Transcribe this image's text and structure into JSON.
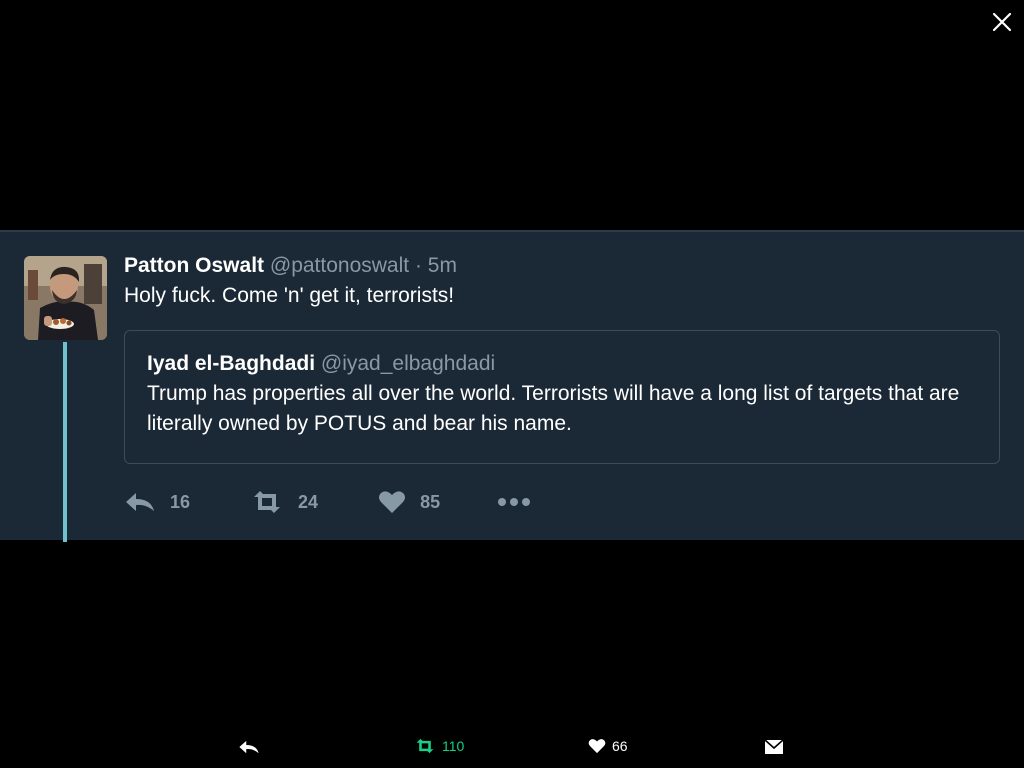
{
  "viewer": {
    "close_icon": "close-icon"
  },
  "tweet": {
    "display_name": "Patton Oswalt",
    "handle": "@pattonoswalt",
    "separator": "·",
    "time": "5m",
    "text": "Holy fuck. Come 'n' get it, terrorists!",
    "quoted": {
      "display_name": "Iyad el-Baghdadi",
      "handle": "@iyad_elbaghdadi",
      "text": "Trump has properties all over the world. Terrorists will have a long list of targets that are literally owned by POTUS and bear his name."
    },
    "actions": {
      "reply_count": "16",
      "retweet_count": "24",
      "like_count": "85",
      "more_icon": "more-dots-icon"
    }
  },
  "bottom_bar": {
    "retweet_count": "110",
    "like_count": "66",
    "colors": {
      "retweet": "#19cf86",
      "thread_line": "#6fc2cc",
      "card_bg": "#1b2836"
    }
  }
}
